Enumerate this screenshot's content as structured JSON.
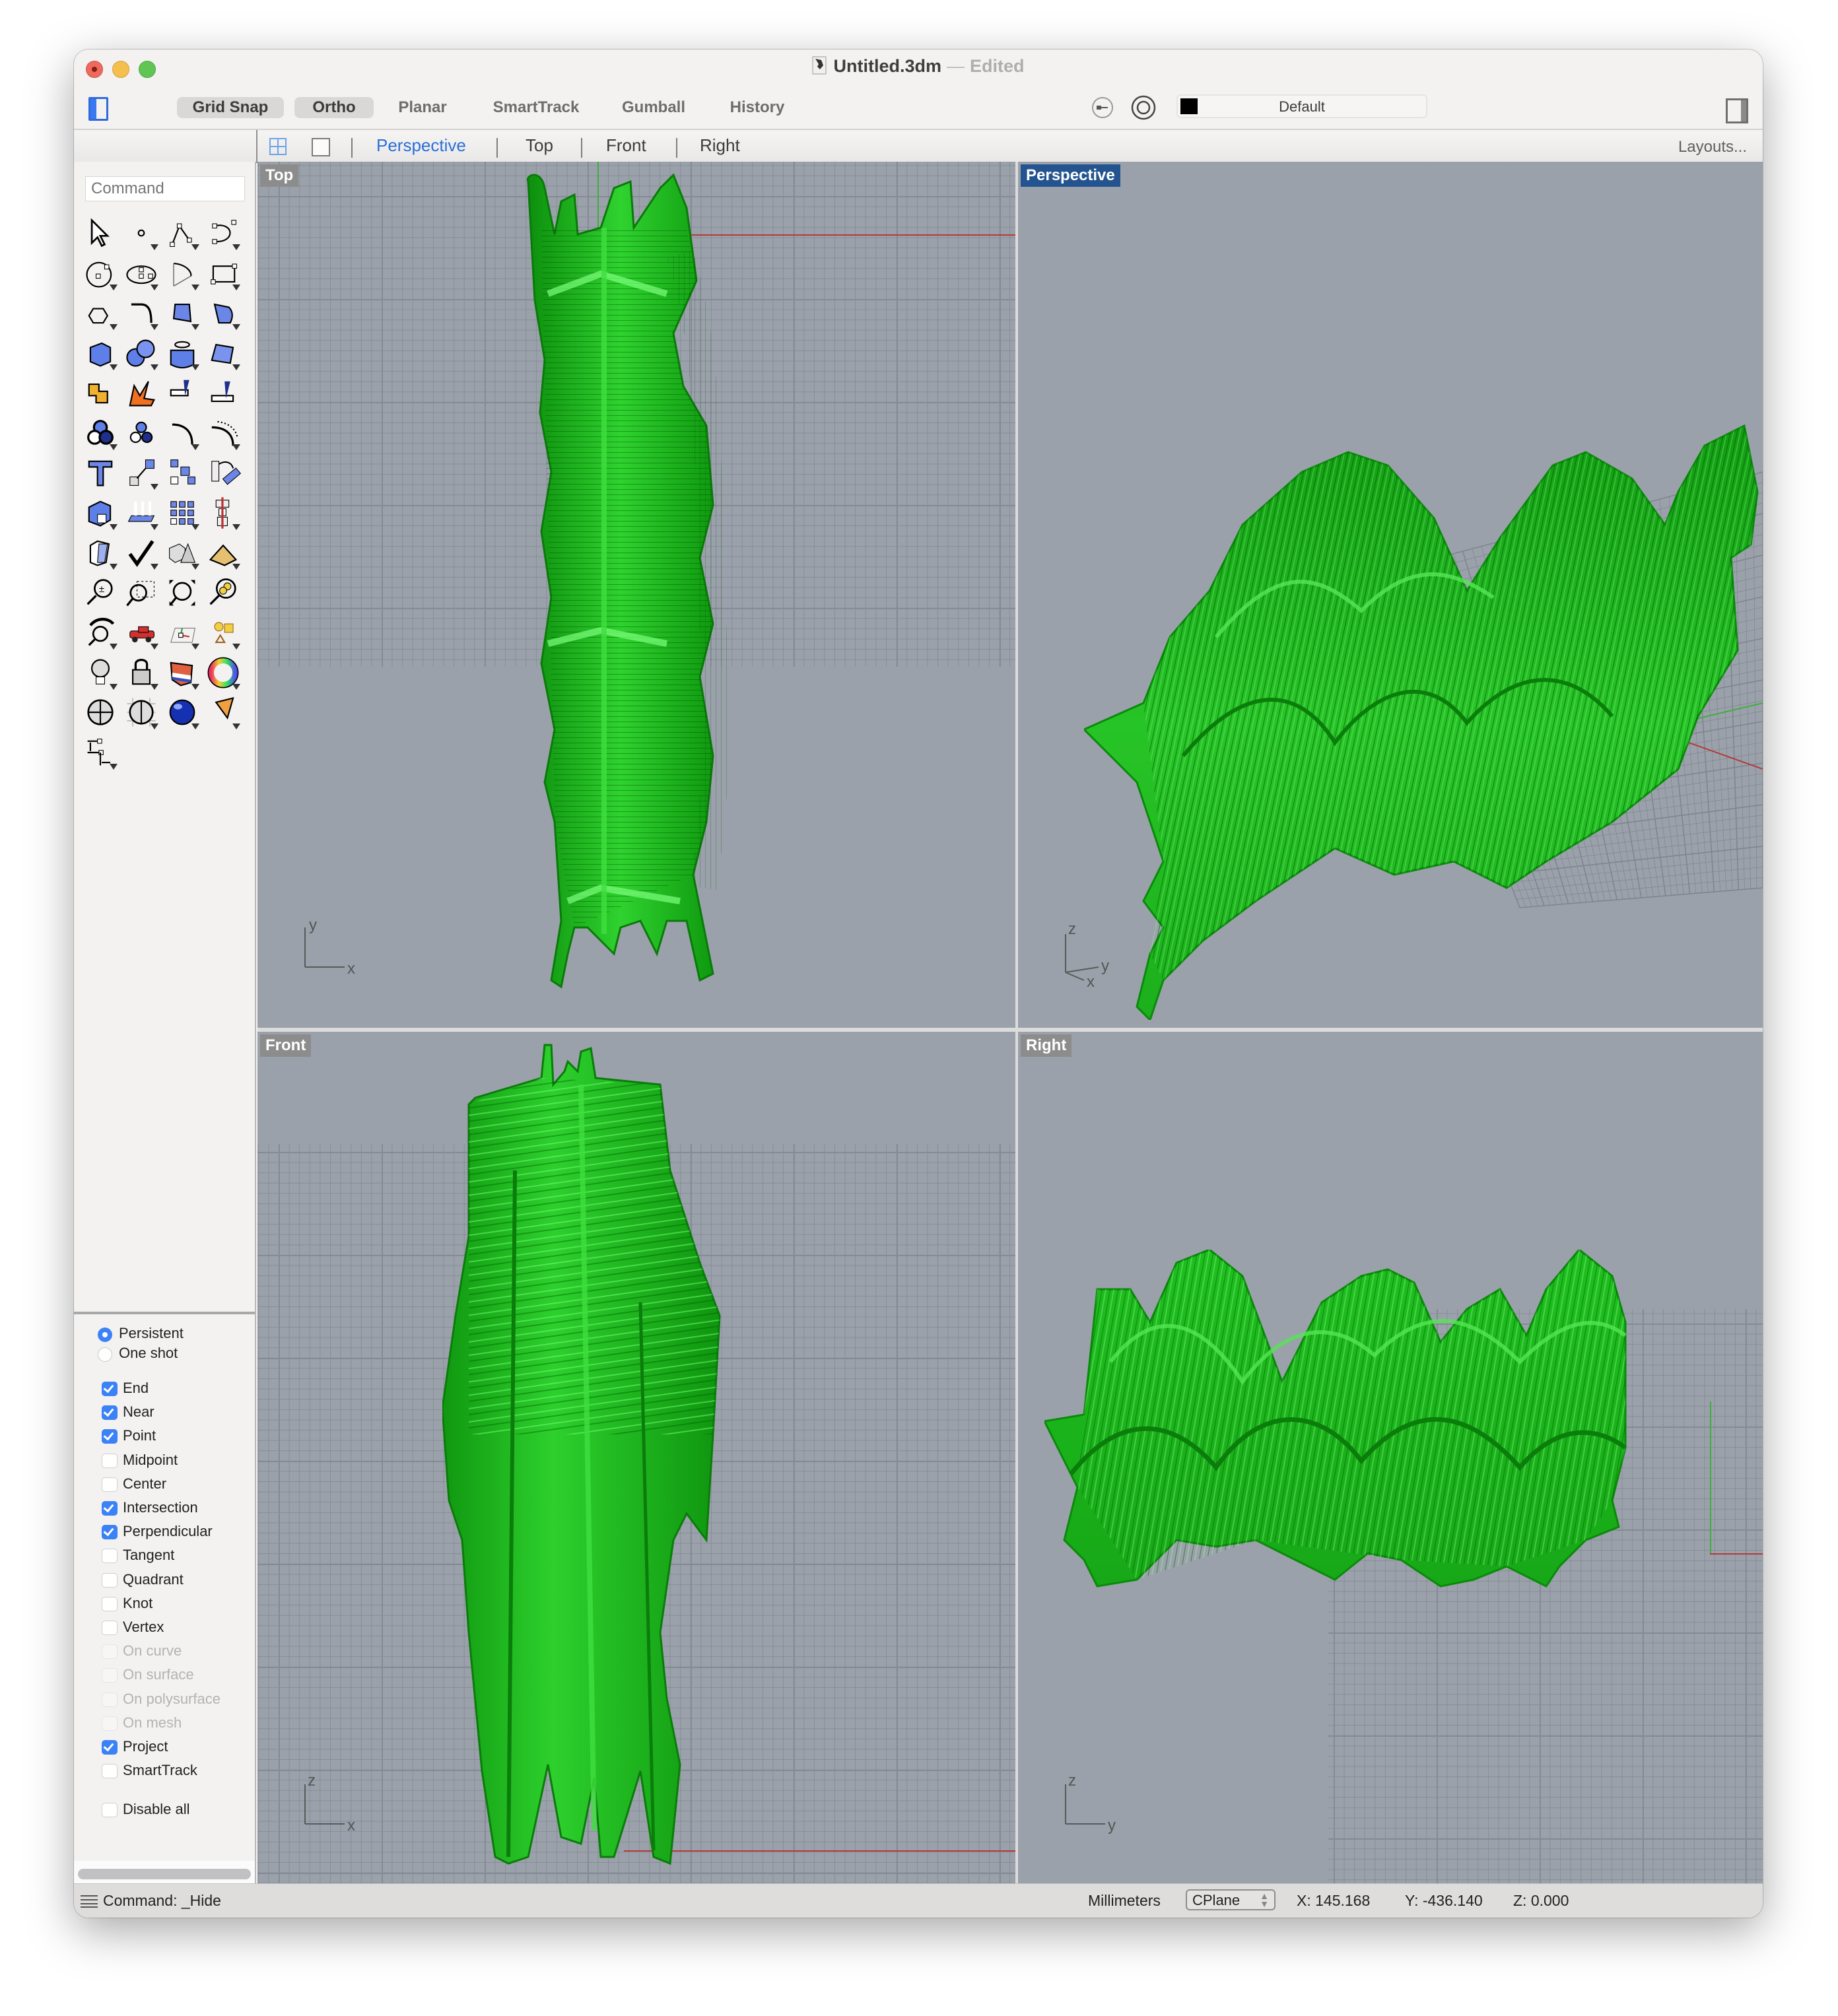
{
  "window": {
    "document_title": "Untitled.3dm",
    "title_separator": "—",
    "document_state": "Edited"
  },
  "toolbar": {
    "modes": [
      {
        "label": "Grid Snap",
        "active": true
      },
      {
        "label": "Ortho",
        "active": true
      },
      {
        "label": "Planar",
        "active": false
      },
      {
        "label": "SmartTrack",
        "active": false
      },
      {
        "label": "Gumball",
        "active": false
      },
      {
        "label": "History",
        "active": false
      }
    ],
    "layer": {
      "name": "Default",
      "color": "#000000"
    }
  },
  "viewport_tabs": {
    "tabs": [
      "Perspective",
      "Top",
      "Front",
      "Right"
    ],
    "active": "Perspective",
    "layouts_label": "Layouts..."
  },
  "sidebar": {
    "command_placeholder": "Command",
    "tools": [
      "select-arrow",
      "point",
      "polyline",
      "curve",
      "circle",
      "ellipse",
      "arc",
      "rectangle",
      "polygon",
      "fillet-curve",
      "surface-from-points",
      "extrude-curve",
      "box-solid",
      "sphere-boolean",
      "cylinder-pipe",
      "surface-deform",
      "join",
      "explode",
      "trim",
      "split",
      "boolean-group",
      "group",
      "offset-curve",
      "offset-curve-dotted",
      "text",
      "move",
      "array-copy",
      "rotate-transform",
      "solid-edit",
      "extrude-up",
      "grid-array",
      "center-align",
      "analyze-curvature",
      "check",
      "shapes",
      "gumball-pyramid",
      "zoom-in-out",
      "zoom-window",
      "zoom-extents",
      "zoom-selected",
      "rotate-view",
      "walkabout-car",
      "cplane-grid",
      "select-shapes",
      "light",
      "lock",
      "layer-material",
      "color-wheel",
      "render-sphere",
      "render-grid-sphere",
      "material-sphere",
      "cone-spotlight",
      "dimension"
    ],
    "osnap": {
      "modes": [
        {
          "label": "Persistent",
          "selected": true
        },
        {
          "label": "One shot",
          "selected": false
        }
      ],
      "items": [
        {
          "label": "End",
          "checked": true,
          "enabled": true
        },
        {
          "label": "Near",
          "checked": true,
          "enabled": true
        },
        {
          "label": "Point",
          "checked": true,
          "enabled": true
        },
        {
          "label": "Midpoint",
          "checked": false,
          "enabled": true
        },
        {
          "label": "Center",
          "checked": false,
          "enabled": true
        },
        {
          "label": "Intersection",
          "checked": true,
          "enabled": true
        },
        {
          "label": "Perpendicular",
          "checked": true,
          "enabled": true
        },
        {
          "label": "Tangent",
          "checked": false,
          "enabled": true
        },
        {
          "label": "Quadrant",
          "checked": false,
          "enabled": true
        },
        {
          "label": "Knot",
          "checked": false,
          "enabled": true
        },
        {
          "label": "Vertex",
          "checked": false,
          "enabled": true
        },
        {
          "label": "On curve",
          "checked": false,
          "enabled": false
        },
        {
          "label": "On surface",
          "checked": false,
          "enabled": false
        },
        {
          "label": "On polysurface",
          "checked": false,
          "enabled": false
        },
        {
          "label": "On mesh",
          "checked": false,
          "enabled": false
        },
        {
          "label": "Project",
          "checked": true,
          "enabled": true
        },
        {
          "label": "SmartTrack",
          "checked": false,
          "enabled": true
        }
      ],
      "disable_all": {
        "label": "Disable all",
        "checked": false
      }
    }
  },
  "viewports": [
    {
      "name": "Top",
      "active": false,
      "axes": [
        "y",
        "x"
      ]
    },
    {
      "name": "Perspective",
      "active": true,
      "axes": [
        "z",
        "y",
        "x"
      ]
    },
    {
      "name": "Front",
      "active": false,
      "axes": [
        "z",
        "x"
      ]
    },
    {
      "name": "Right",
      "active": false,
      "axes": [
        "z",
        "y"
      ]
    }
  ],
  "colors": {
    "model_green": "#1fb51f",
    "viewport_bg": "#9aa1aa",
    "active_label_bg": "#23548f",
    "x_axis": "#b33a3a",
    "y_axis": "#3fae3f",
    "accent_blue": "#3b82f6"
  },
  "statusbar": {
    "command": "Command: _Hide",
    "units": "Millimeters",
    "cplane": "CPlane",
    "x": "X: 145.168",
    "y": "Y: -436.140",
    "z": "Z: 0.000"
  }
}
